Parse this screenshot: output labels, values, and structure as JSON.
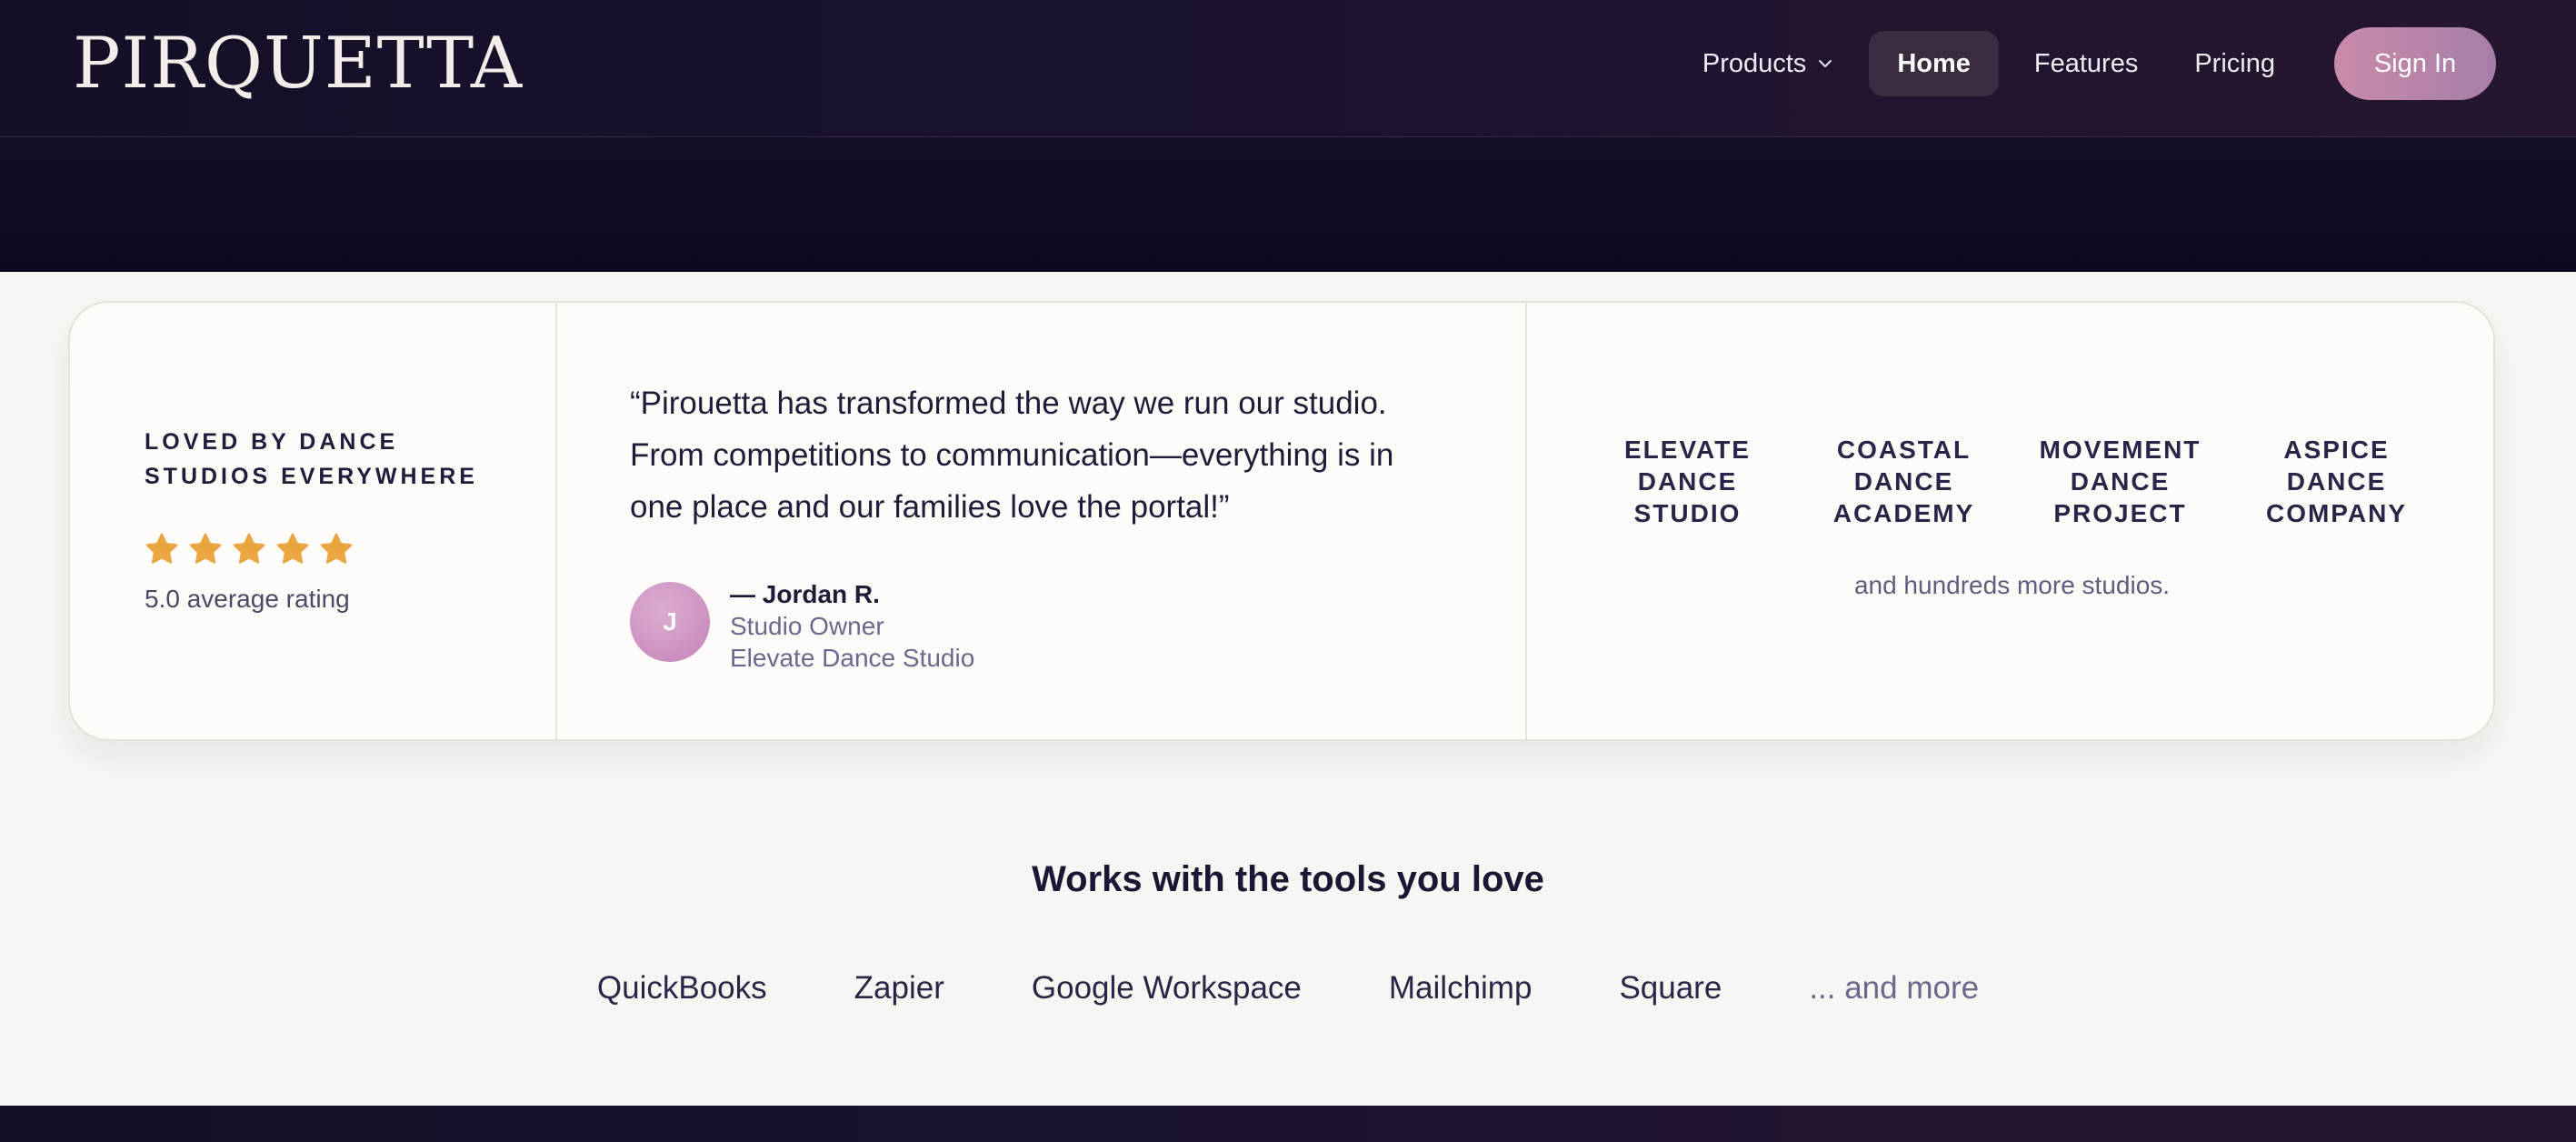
{
  "header": {
    "logo": "PIRQUETTA",
    "nav": {
      "products": "Products",
      "home": "Home",
      "features": "Features",
      "pricing": "Pricing",
      "signin": "Sign In"
    }
  },
  "testimonial": {
    "loved_line1": "LOVED BY DANCE",
    "loved_line2": "STUDIOS EVERYWHERE",
    "star_count": 5,
    "star_color": "#e8a540",
    "rating_text": "5.0 average rating",
    "quote": "“Pirouetta has transformed the way we run our studio. From competitions to communication—everything is in one place and our families love the portal!”",
    "avatar_initial": "J",
    "author_name": "— Jordan R.",
    "author_role": "Studio Owner",
    "author_studio": "Elevate Dance Studio"
  },
  "studios": [
    {
      "line1": "ELEVATE",
      "line2": "DANCE",
      "line3": "STUDIO"
    },
    {
      "line1": "COASTAL",
      "line2": "DANCE",
      "line3": "ACADEMY"
    },
    {
      "line1": "MOVEMENT",
      "line2": "DANCE",
      "line3": "PROJECT"
    },
    {
      "line1": "ASPICE",
      "line2": "DANCE",
      "line3": "COMPANY"
    }
  ],
  "studios_more": "and hundreds more studios.",
  "tools": {
    "title": "Works with the tools you love",
    "items": [
      "QuickBooks",
      "Zapier",
      "Google Workspace",
      "Mailchimp",
      "Square"
    ],
    "more": "... and more"
  },
  "colors": {
    "accent": "#c98aa9",
    "dark": "#130f26",
    "ink": "#1f1b3a"
  }
}
